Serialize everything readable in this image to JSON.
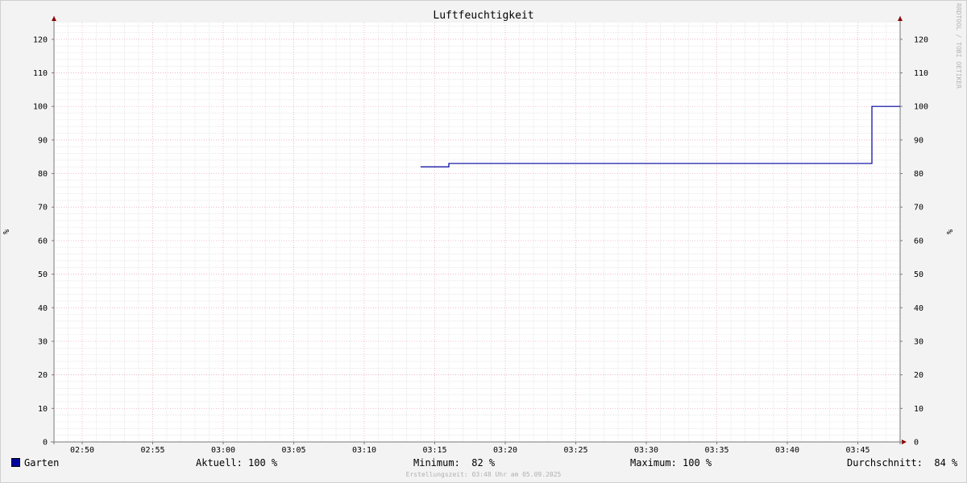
{
  "chart_data": {
    "type": "line",
    "title": "Luftfeuchtigkeit",
    "ylabel": "%",
    "ylabel_right": "%",
    "ylim": [
      0,
      125
    ],
    "y_ticks": [
      0,
      10,
      20,
      30,
      40,
      50,
      60,
      70,
      80,
      90,
      100,
      110,
      120
    ],
    "x_range": [
      "02:48",
      "03:48"
    ],
    "x_ticks": [
      "02:50",
      "02:55",
      "03:00",
      "03:05",
      "03:10",
      "03:15",
      "03:20",
      "03:25",
      "03:30",
      "03:35",
      "03:40",
      "03:45"
    ],
    "grid": true,
    "series": [
      {
        "name": "Garten",
        "color": "#00009c",
        "step": true,
        "points": [
          {
            "x": "03:14",
            "y": 82
          },
          {
            "x": "03:16",
            "y": 83
          },
          {
            "x": "03:46",
            "y": 100
          },
          {
            "x": "03:48",
            "y": 100
          }
        ]
      }
    ]
  },
  "legend": {
    "series_name": "Garten",
    "aktuell": "Aktuell: 100 %",
    "minimum": "Minimum:  82 %",
    "maximum": "Maximum: 100 %",
    "durchschnitt": "Durchschnitt:  84 %"
  },
  "credit": "RRDTOOL / TOBI OETIKER",
  "footer": "Erstellungszeit: 03:48 Uhr am 05.09.2025",
  "colors": {
    "line": "#00009c",
    "minor_grid": "#d9d9d9",
    "major_grid": "#e8a0b0",
    "axis": "#7a7a7a",
    "arrow": "#8b0000",
    "plot_bg": "#ffffff"
  }
}
